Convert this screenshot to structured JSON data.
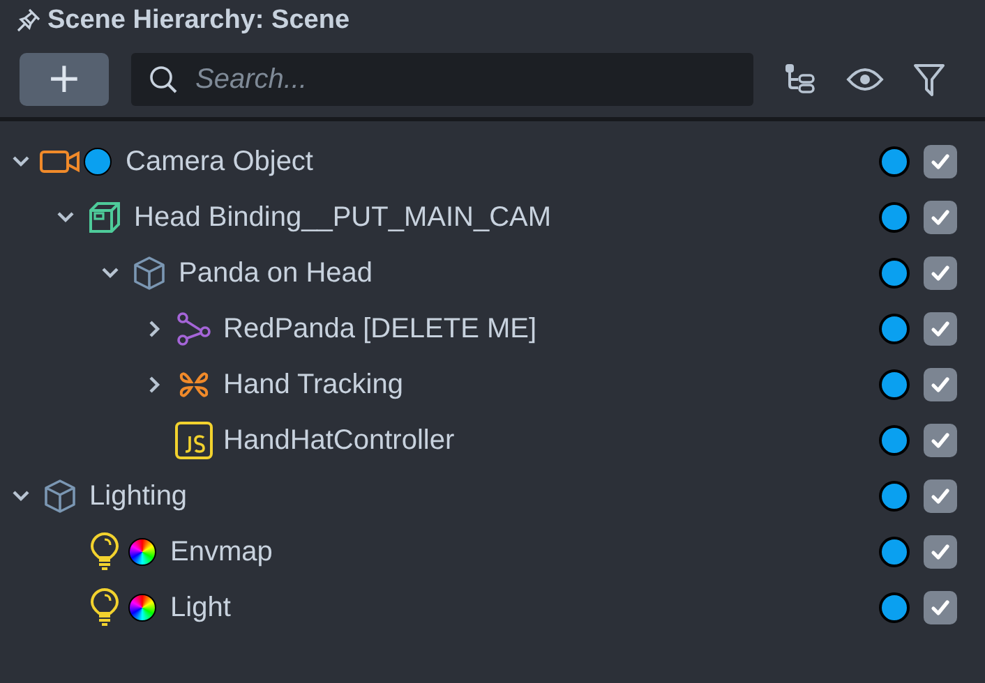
{
  "panel": {
    "title": "Scene Hierarchy: Scene"
  },
  "toolbar": {
    "add_label": "+",
    "search": {
      "placeholder": "Search..."
    }
  },
  "tree": [
    {
      "label": "Camera Object",
      "kind": "camera",
      "color": "#0aa0f0",
      "expanded": true,
      "checked": true,
      "children": [
        {
          "label": "Head Binding__PUT_MAIN_CAM",
          "kind": "binding",
          "expanded": true,
          "checked": true,
          "children": [
            {
              "label": "Panda on Head",
              "kind": "object",
              "expanded": true,
              "checked": true,
              "children": [
                {
                  "label": "RedPanda [DELETE ME]",
                  "kind": "prefab",
                  "expanded": false,
                  "checked": true
                },
                {
                  "label": "Hand Tracking",
                  "kind": "tracking",
                  "expanded": false,
                  "checked": true
                },
                {
                  "label": "HandHatController",
                  "kind": "script",
                  "checked": true
                }
              ]
            }
          ]
        }
      ]
    },
    {
      "label": "Lighting",
      "kind": "object",
      "expanded": true,
      "checked": true,
      "children": [
        {
          "label": "Envmap",
          "kind": "light",
          "color_wheel": true,
          "checked": true
        },
        {
          "label": "Light",
          "kind": "light",
          "color_wheel": true,
          "checked": true
        }
      ]
    }
  ]
}
